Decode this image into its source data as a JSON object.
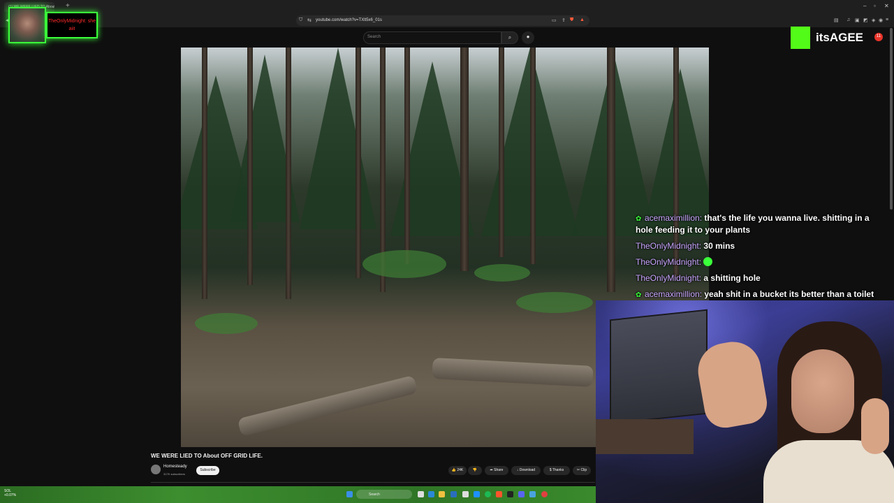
{
  "browser": {
    "tab_title": "(1) WE WERE LIED TO About OFF",
    "url": "youtube.com/watch?v=TXlt5x6_01s",
    "new_tab": "+"
  },
  "youtube": {
    "search_placeholder": "Search",
    "video_title": "WE WERE LIED TO About OFF GRID LIFE.",
    "channel_name": "Homesteady",
    "channel_subs": "317K subscribers",
    "subscribe_label": "Subscribe",
    "likes": "24K",
    "share_label": "Share",
    "download_label": "Download",
    "thanks_label": "Thanks",
    "clip_label": "Clip"
  },
  "overlay": {
    "top_cam_name": "TheOnlyMidnight: she aiit",
    "streamer": "itsAGEE",
    "notification_count": "11"
  },
  "chat": [
    {
      "user": "acemaximillion:",
      "text": "that's the life you wanna live. shitting in a hole feeding it to your plants",
      "badge": true
    },
    {
      "user": "TheOnlyMidnight:",
      "text": "30 mins",
      "badge": false
    },
    {
      "user": "TheOnlyMidnight:",
      "text": "",
      "emote": true,
      "badge": false
    },
    {
      "user": "TheOnlyMidnight:",
      "text": "a shitting hole",
      "badge": false
    },
    {
      "user": "acemaximillion:",
      "text": "yeah shit in a bucket its better than a toilet",
      "badge": true
    }
  ],
  "taskbar": {
    "weather_temp": "SOL",
    "weather_sub": "+0.07%",
    "search_label": "Search"
  },
  "colors": {
    "kick_green": "#53fc18",
    "chat_user": "#c9a6ff",
    "cam_glow": "#3aff3a"
  }
}
